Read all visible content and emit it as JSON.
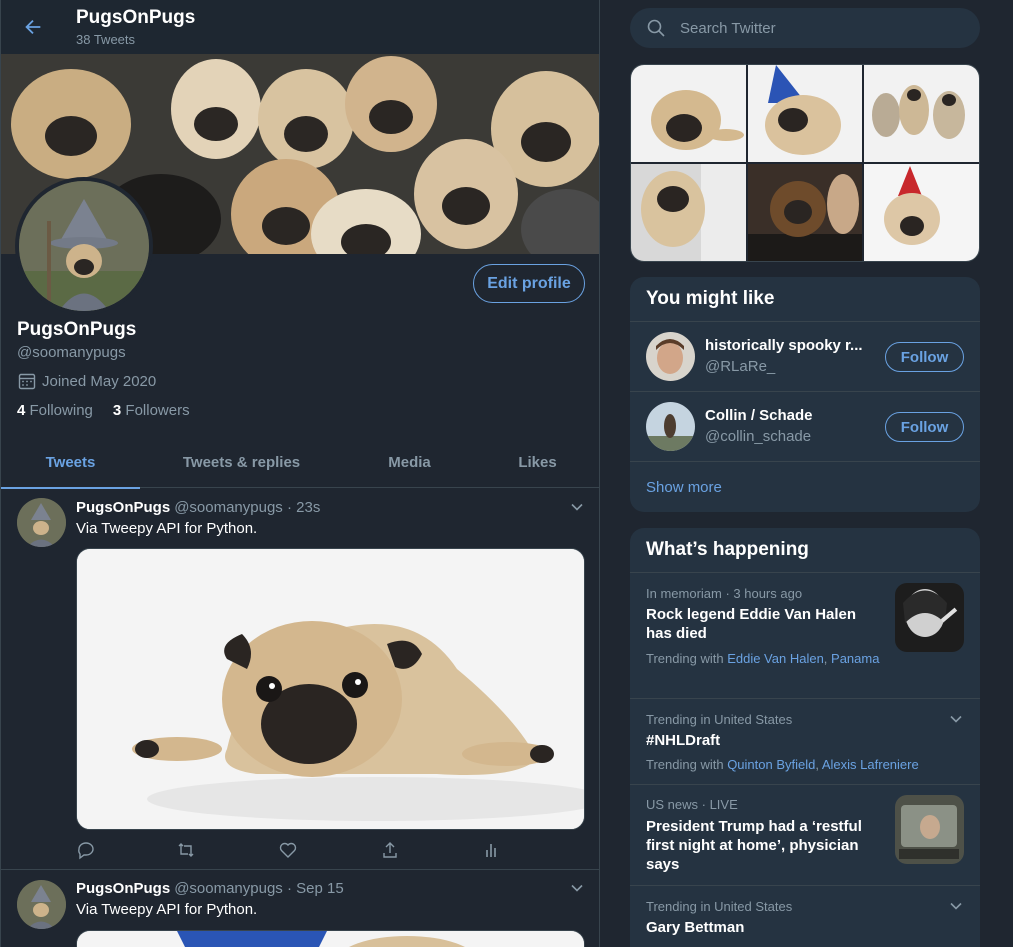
{
  "header": {
    "title": "PugsOnPugs",
    "subtitle": "38 Tweets"
  },
  "profile": {
    "name": "PugsOnPugs",
    "handle": "@soomanypugs",
    "joined": "Joined May 2020",
    "following_count": "4",
    "following_label": "Following",
    "followers_count": "3",
    "followers_label": "Followers",
    "edit_label": "Edit profile"
  },
  "tabs": [
    {
      "label": "Tweets",
      "active": true
    },
    {
      "label": "Tweets & replies",
      "active": false
    },
    {
      "label": "Media",
      "active": false
    },
    {
      "label": "Likes",
      "active": false
    }
  ],
  "tweets": [
    {
      "name": "PugsOnPugs",
      "handle": "@soomanypugs",
      "sep": "·",
      "time": "23s",
      "text": "Via Tweepy API for Python."
    },
    {
      "name": "PugsOnPugs",
      "handle": "@soomanypugs",
      "sep": "·",
      "time": "Sep 15",
      "text": "Via Tweepy API for Python."
    }
  ],
  "search": {
    "placeholder": "Search Twitter"
  },
  "who_to_follow": {
    "title": "You might like",
    "users": [
      {
        "name": "historically spooky r...",
        "handle": "@RLaRe_",
        "button": "Follow"
      },
      {
        "name": "Collin / Schade",
        "handle": "@collin_schade",
        "button": "Follow"
      }
    ],
    "show_more": "Show more"
  },
  "trends": {
    "title": "What’s happening",
    "items": [
      {
        "meta": "In memoriam · 3 hours ago",
        "title": "Rock legend Eddie Van Halen has died",
        "with_prefix": "Trending with",
        "with_link1": "Eddie Van Halen",
        "with_link2": "Panama"
      },
      {
        "meta": "Trending in United States",
        "title": "#NHLDraft",
        "with_prefix": "Trending with",
        "with_link1": "Quinton Byfield",
        "with_link2": "Alexis Lafreniere"
      },
      {
        "meta": "US news · LIVE",
        "title": "President Trump had a ‘restful first night at home’, physician says"
      },
      {
        "meta": "Trending in United States",
        "title": "Gary Bettman"
      }
    ]
  },
  "colors": {
    "background": "#1f2630",
    "accent": "#6aa2e2",
    "secondary_text": "#8899a6",
    "card": "#253341",
    "border": "#38444d"
  }
}
